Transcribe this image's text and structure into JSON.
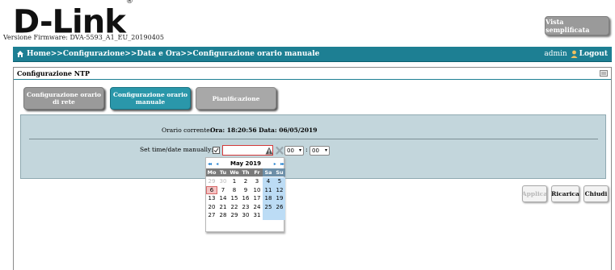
{
  "header": {
    "logo_text": "D-Link",
    "logo_mark": "®",
    "firmware": "Versione Firmware: DVA-5593_A1_EU_20190405",
    "simplified_view": "Vista semplificata"
  },
  "navbar": {
    "breadcrumb": "Home>>Configurazione>>Data e Ora>>Configurazione orario manuale",
    "user": "admin",
    "logout": "Logout",
    "color": "#1d7f93"
  },
  "panel": {
    "title": "Configurazione NTP",
    "tabs": [
      {
        "label": "Configurazione orario di rete",
        "active": false
      },
      {
        "label": "Configurazione orario manuale",
        "active": true
      },
      {
        "label": "Pianificazione",
        "active": false
      }
    ]
  },
  "form": {
    "current_time_label": "Orario corrente:",
    "current_time_value": "Ora: 18:20:56   Data: 06/05/2019",
    "manual_label": "Set time/date manually:",
    "manual_checked": "☑",
    "date_value": "",
    "hour_value": "00",
    "minute_value": "00",
    "separator": ":"
  },
  "calendar": {
    "prev_year": "◂◂",
    "prev_month": "◂",
    "month_label": "May 2019",
    "next_month": "▸",
    "next_year": "▸▸",
    "weekdays": [
      "Mo",
      "Tu",
      "We",
      "Th",
      "Fr",
      "Sa",
      "Su"
    ],
    "weeks": [
      [
        "29",
        "30",
        "1",
        "2",
        "3",
        "4",
        "5"
      ],
      [
        "6",
        "7",
        "8",
        "9",
        "10",
        "11",
        "12"
      ],
      [
        "13",
        "14",
        "15",
        "16",
        "17",
        "18",
        "19"
      ],
      [
        "20",
        "21",
        "22",
        "23",
        "24",
        "25",
        "26"
      ],
      [
        "27",
        "28",
        "29",
        "30",
        "31",
        "",
        ""
      ]
    ],
    "today": "6"
  },
  "buttons": {
    "apply": "Applica",
    "reload": "Ricarica",
    "close": "Chiudi"
  }
}
